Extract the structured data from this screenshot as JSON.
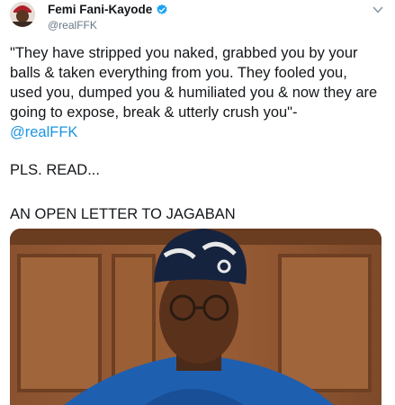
{
  "tweet": {
    "author_name": "Femi Fani-Kayode",
    "author_handle": "@realFFK",
    "quote_text": "\"They have stripped you naked, grabbed you by your balls & taken everything from you. They fooled you, used you, dumped you & humiliated you & now they are going to expose, break & utterly crush you\"-",
    "mention": "@realFFK",
    "line_2": "PLS. READ...",
    "line_3": "AN OPEN LETTER TO JAGABAN",
    "verified_icon": "verified-badge-icon",
    "menu_icon": "chevron-down-icon",
    "colors": {
      "link": "#1b95e0",
      "secondary_text": "#657786",
      "primary_text": "#14171a",
      "verified": "#1da1f2"
    }
  }
}
